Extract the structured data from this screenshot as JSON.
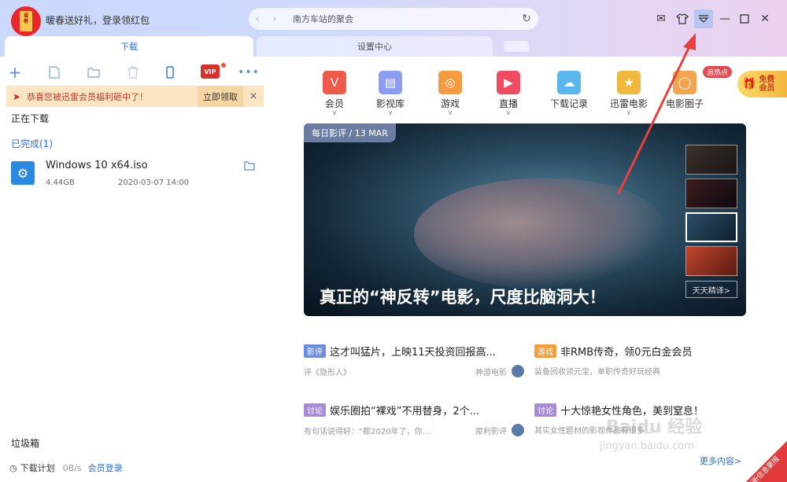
{
  "titlebar": {
    "promo_text": "暖春送好礼，登录领红包",
    "address": "南方车站的聚会"
  },
  "tabs": {
    "download": "下载",
    "settings": "设置中心"
  },
  "banner": {
    "text": "恭喜您被迅雷会员福利砸中了！",
    "button": "立即领取",
    "close": "×"
  },
  "toolbar": {
    "vip_label": "VIP"
  },
  "sections": {
    "downloading": "正在下载",
    "completed": "已完成(1)",
    "trash": "垃圾箱"
  },
  "file": {
    "name": "Windows 10 x64.iso",
    "size": "4.44GB",
    "date": "2020-03-07 14:00"
  },
  "status_bar": {
    "plan": "下载计划",
    "speed": "0B/s",
    "login": "会员登录"
  },
  "categories": [
    {
      "label": "会员",
      "dropdown": true,
      "color": "#ef5a4a",
      "icon": "heart-v-icon"
    },
    {
      "label": "影视库",
      "dropdown": true,
      "color": "#8c9cf0",
      "icon": "film-icon"
    },
    {
      "label": "游戏",
      "dropdown": true,
      "color": "#f59a3e",
      "icon": "gamepad-icon"
    },
    {
      "label": "直播",
      "dropdown": true,
      "color": "#ef4c62",
      "icon": "tv-icon"
    },
    {
      "label": "下载记录",
      "dropdown": false,
      "color": "#5ab7ee",
      "icon": "cloud-icon"
    },
    {
      "label": "迅雷电影",
      "dropdown": true,
      "color": "#f1b93b",
      "icon": "bird-icon"
    },
    {
      "label": "电影圈子",
      "dropdown": false,
      "color": "#f2a54d",
      "icon": "circle-icon"
    }
  ],
  "hot_badge": "追热点",
  "vip_card": {
    "line1": "免费",
    "line2": "会员"
  },
  "feature": {
    "tag": "每日影评 / 13 MAR",
    "title": "真正的“神反转”电影，尺度比脑洞大！",
    "more": "天天精译>"
  },
  "news": [
    {
      "badge": "影评",
      "badge_color": "blue",
      "title": "这才叫猛片，上映11天投资回报高...",
      "desc": "评《隐形人》",
      "source": "神游电影"
    },
    {
      "badge": "游戏",
      "badge_color": "orange",
      "title": "非RMB传奇，领0元白金会员",
      "desc": "装备回收领元宝，单职传奇好玩经典",
      "source": ""
    },
    {
      "badge": "讨论",
      "badge_color": "purple",
      "title": "娱乐圈拍“裸戏”不用替身，2个...",
      "desc": "有句话说得好：“都2020年了，你...",
      "source": "犀利影评"
    },
    {
      "badge": "讨论",
      "badge_color": "purple",
      "title": "十大惊艳女性角色，美到窒息！",
      "desc": "其实女性题材的影视作品有很多...",
      "source": ""
    }
  ],
  "more_content": "更多内容>",
  "corner_badge": "有新信息要报",
  "watermark": {
    "brand": "Baidu 经验",
    "url": "jingyan.baidu.com"
  }
}
